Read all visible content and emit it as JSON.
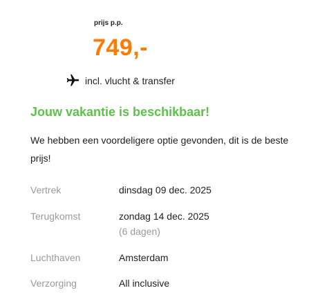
{
  "price": {
    "label": "prijs p.p.",
    "amount": "749,-"
  },
  "includes": {
    "icon": "airplane-icon",
    "text": "incl. vlucht & transfer"
  },
  "availability": {
    "title": "Jouw vakantie is beschikbaar!",
    "description": "We hebben een voordeligere optie gevonden, dit is de beste prijs!"
  },
  "details": [
    {
      "label": "Vertrek",
      "value": "dinsdag 09 dec. 2025"
    },
    {
      "label": "Terugkomst",
      "value": "zondag 14 dec. 2025",
      "sub": "(6 dagen)"
    },
    {
      "label": "Luchthaven",
      "value": "Amsterdam"
    },
    {
      "label": "Verzorging",
      "value": "All inclusive"
    }
  ],
  "colors": {
    "price": "#ff7a00",
    "available": "#5cc24a",
    "muted": "#9a9a9a",
    "text": "#222222"
  }
}
